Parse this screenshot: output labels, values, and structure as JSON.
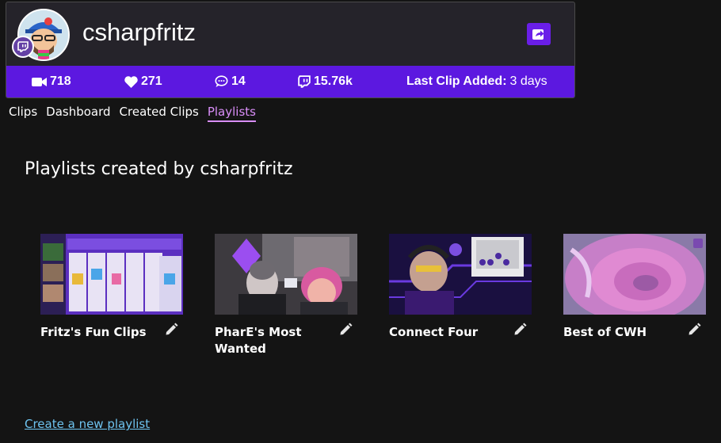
{
  "profile": {
    "username": "csharpfritz",
    "avatar_icon": "avatar-cartoon-icon",
    "badge_icon": "twitch-icon",
    "share_icon": "share-icon",
    "accent_color": "#5c18e0"
  },
  "stats": {
    "clips": "718",
    "likes": "271",
    "comments": "14",
    "followers": "15.76k",
    "last_clip_label": "Last Clip Added:",
    "last_clip_value": "3 days"
  },
  "nav": {
    "items": [
      "Clips",
      "Dashboard",
      "Created Clips",
      "Playlists"
    ],
    "active": "Playlists"
  },
  "section_title": "Playlists created by csharpfritz",
  "playlists": [
    {
      "title": "Fritz's Fun Clips"
    },
    {
      "title": "PharE's Most Wanted"
    },
    {
      "title": "Connect Four"
    },
    {
      "title": "Best of CWH"
    }
  ],
  "create_link": "Create a new playlist"
}
